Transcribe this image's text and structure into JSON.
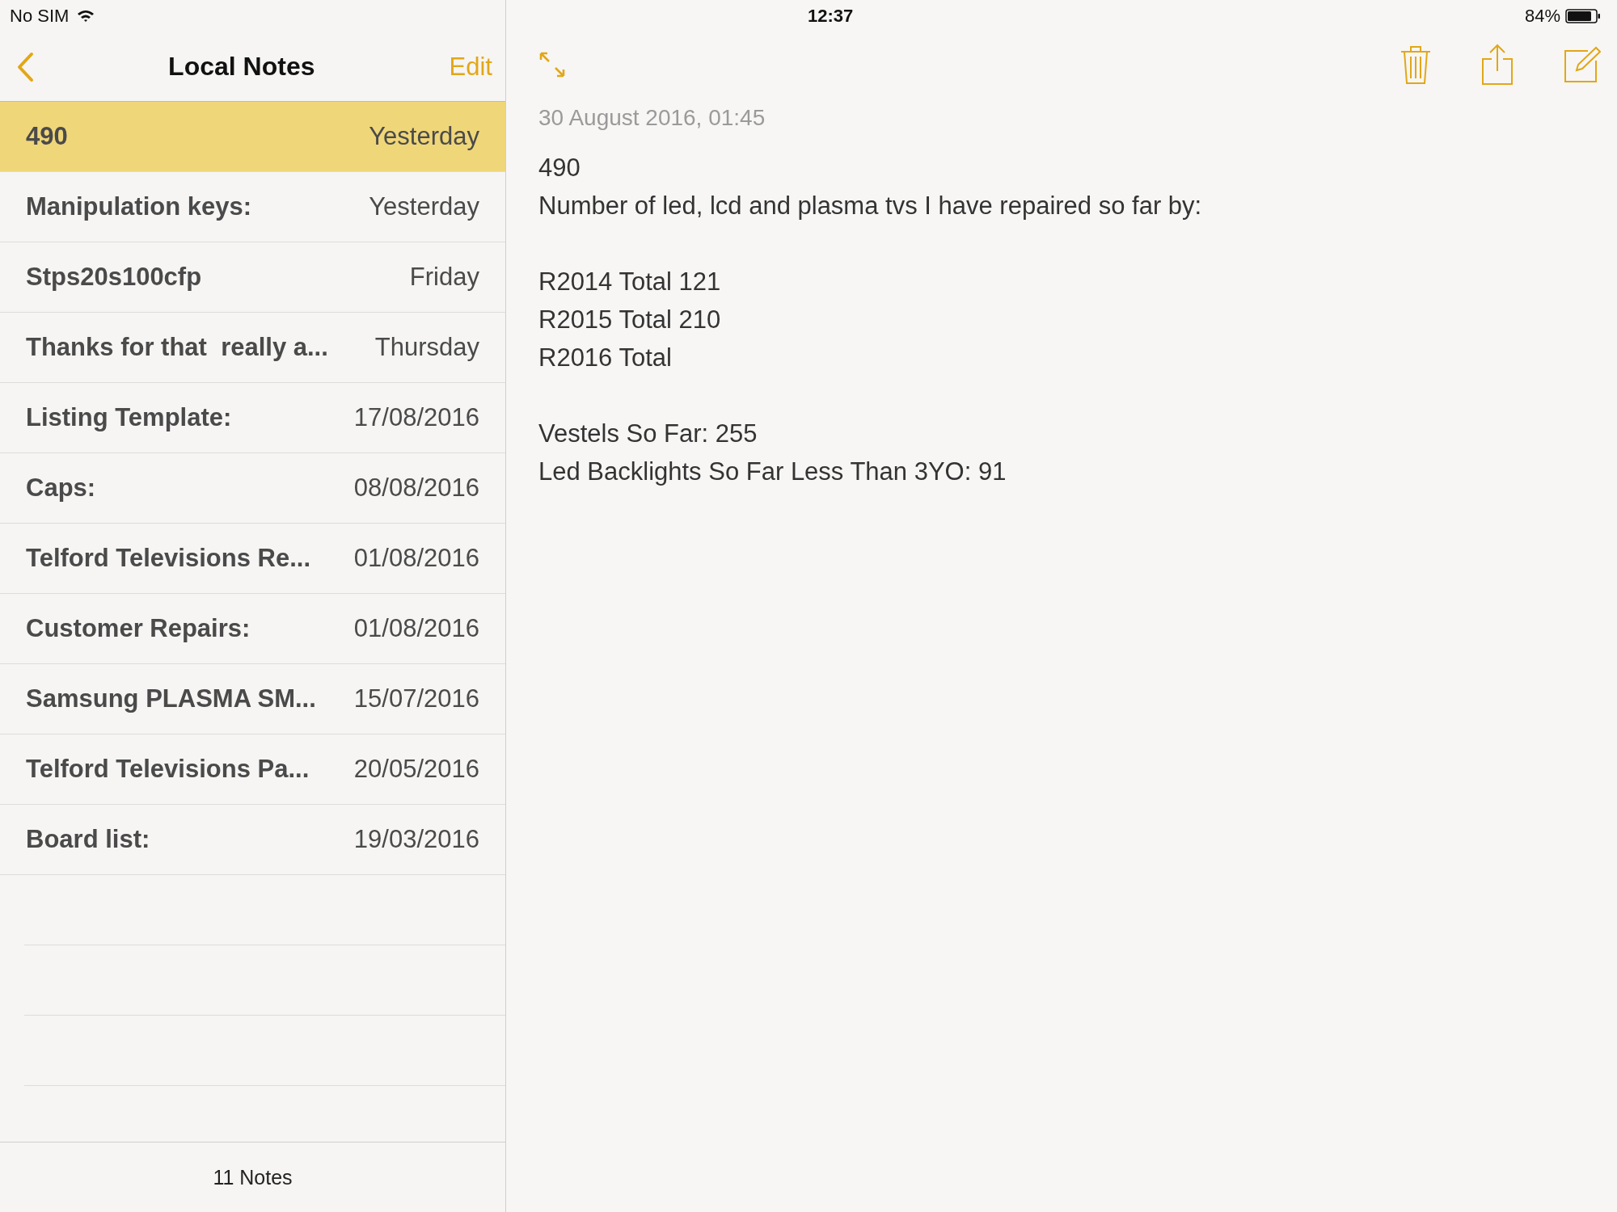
{
  "status_bar": {
    "carrier": "No SIM",
    "time": "12:37",
    "battery": "84%"
  },
  "sidebar": {
    "title": "Local Notes",
    "edit": "Edit",
    "notes": [
      {
        "title": "490",
        "date": "Yesterday",
        "selected": true
      },
      {
        "title": "Manipulation keys:",
        "date": "Yesterday",
        "selected": false
      },
      {
        "title": "Stps20s100cfp",
        "date": "Friday",
        "selected": false
      },
      {
        "title": "Thanks for that  really a...",
        "date": "Thursday",
        "selected": false
      },
      {
        "title": "Listing Template:",
        "date": "17/08/2016",
        "selected": false
      },
      {
        "title": "Caps:",
        "date": "08/08/2016",
        "selected": false
      },
      {
        "title": "Telford Televisions Re...",
        "date": "01/08/2016",
        "selected": false
      },
      {
        "title": "Customer Repairs:",
        "date": "01/08/2016",
        "selected": false
      },
      {
        "title": "Samsung PLASMA SM...",
        "date": "15/07/2016",
        "selected": false
      },
      {
        "title": "Telford Televisions Pa...",
        "date": "20/05/2016",
        "selected": false
      },
      {
        "title": "Board list:",
        "date": "19/03/2016",
        "selected": false
      }
    ],
    "count": "11 Notes"
  },
  "note": {
    "date": "30 August 2016, 01:45",
    "paragraphs": [
      {
        "lines": [
          "490",
          "Number of led, lcd and plasma tvs I have repaired so far by:"
        ]
      },
      {
        "lines": [
          "R2014 Total 121",
          "R2015 Total 210",
          "R2016 Total"
        ]
      },
      {
        "lines": [
          "Vestels So Far: 255",
          "Led Backlights So Far Less Than 3YO: 91"
        ]
      }
    ]
  }
}
